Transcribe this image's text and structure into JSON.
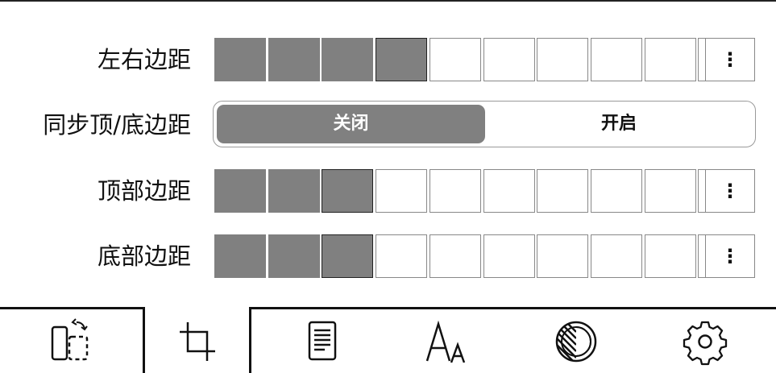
{
  "rows": {
    "lr_margin": {
      "label": "左右边距",
      "level": 4,
      "segments": 10
    },
    "sync": {
      "label": "同步顶/底边距",
      "options": [
        "关闭",
        "开启"
      ],
      "selected": "关闭"
    },
    "top_margin": {
      "label": "顶部边距",
      "level": 3,
      "segments": 10
    },
    "bottom_margin": {
      "label": "底部边距",
      "level": 3,
      "segments": 10
    }
  },
  "more_glyph": "⋮",
  "toolbar": {
    "items": [
      {
        "name": "rotate-icon",
        "active": false
      },
      {
        "name": "crop-icon",
        "active": true
      },
      {
        "name": "document-icon",
        "active": false
      },
      {
        "name": "font-size-icon",
        "active": false
      },
      {
        "name": "contrast-icon",
        "active": false
      },
      {
        "name": "gear-icon",
        "active": false
      }
    ]
  },
  "colors": {
    "fill": "#808080",
    "border": "#888888",
    "text": "#111111"
  }
}
